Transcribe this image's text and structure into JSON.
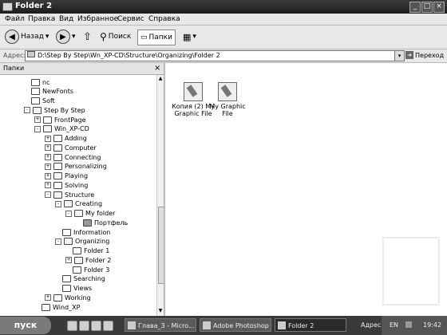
{
  "window": {
    "title": "Folder 2",
    "buttons": [
      "_",
      "□",
      "×"
    ]
  },
  "menu": [
    "Файл",
    "Правка",
    "Вид",
    "Избранное",
    "Сервис",
    "Справка"
  ],
  "toolbar": {
    "back": "Назад",
    "search": "Поиск",
    "folders": "Папки"
  },
  "address": {
    "label": "Адрес:",
    "path": "D:\\Step By Step\\Wn_XP-CD\\Structure\\Organizing\\Folder 2",
    "go": "Переход"
  },
  "pane": {
    "title": "Папки"
  },
  "tree": [
    {
      "label": "nc",
      "level": 0,
      "exp": "",
      "icon": "closed"
    },
    {
      "label": "NewFonts",
      "level": 0,
      "exp": "",
      "icon": "closed"
    },
    {
      "label": "Soft",
      "level": 0,
      "exp": "",
      "icon": "closed"
    },
    {
      "label": "Step By Step",
      "level": 0,
      "exp": "-",
      "icon": "open"
    },
    {
      "label": "FrontPage",
      "level": 1,
      "exp": "+",
      "icon": "closed"
    },
    {
      "label": "Win_XP-CD",
      "level": 1,
      "exp": "-",
      "icon": "open"
    },
    {
      "label": "Adding",
      "level": 2,
      "exp": "+",
      "icon": "closed"
    },
    {
      "label": "Computer",
      "level": 2,
      "exp": "+",
      "icon": "closed"
    },
    {
      "label": "Connecting",
      "level": 2,
      "exp": "+",
      "icon": "closed"
    },
    {
      "label": "Personalizing",
      "level": 2,
      "exp": "+",
      "icon": "closed"
    },
    {
      "label": "Playing",
      "level": 2,
      "exp": "+",
      "icon": "closed"
    },
    {
      "label": "Solving",
      "level": 2,
      "exp": "+",
      "icon": "closed"
    },
    {
      "label": "Structure",
      "level": 2,
      "exp": "-",
      "icon": "open"
    },
    {
      "label": "Creating",
      "level": 3,
      "exp": "-",
      "icon": "open"
    },
    {
      "label": "My folder",
      "level": 4,
      "exp": "-",
      "icon": "open"
    },
    {
      "label": "Портфель",
      "level": 5,
      "exp": "",
      "icon": "doc"
    },
    {
      "label": "Information",
      "level": 3,
      "exp": "",
      "icon": "closed"
    },
    {
      "label": "Organizing",
      "level": 3,
      "exp": "-",
      "icon": "open"
    },
    {
      "label": "Folder 1",
      "level": 4,
      "exp": "",
      "icon": "closed"
    },
    {
      "label": "Folder 2",
      "level": 4,
      "exp": "+",
      "icon": "open"
    },
    {
      "label": "Folder 3",
      "level": 4,
      "exp": "",
      "icon": "closed"
    },
    {
      "label": "Searching",
      "level": 3,
      "exp": "",
      "icon": "closed"
    },
    {
      "label": "Views",
      "level": 3,
      "exp": "",
      "icon": "closed"
    },
    {
      "label": "Working",
      "level": 2,
      "exp": "+",
      "icon": "closed"
    },
    {
      "label": "Wind_XP",
      "level": 1,
      "exp": "",
      "icon": "closed"
    }
  ],
  "files": [
    {
      "line1": "Копия (2) My",
      "line2": "Graphic File"
    },
    {
      "line1": "My Graphic",
      "line2": "File"
    }
  ],
  "taskbar": {
    "start": "пуск",
    "tasks": [
      "Глава_3 - Micro...",
      "Adobe Photoshop",
      "Folder 2"
    ],
    "tray": {
      "extra": "Адрес",
      "lang": "EN",
      "time": "19:42"
    }
  }
}
